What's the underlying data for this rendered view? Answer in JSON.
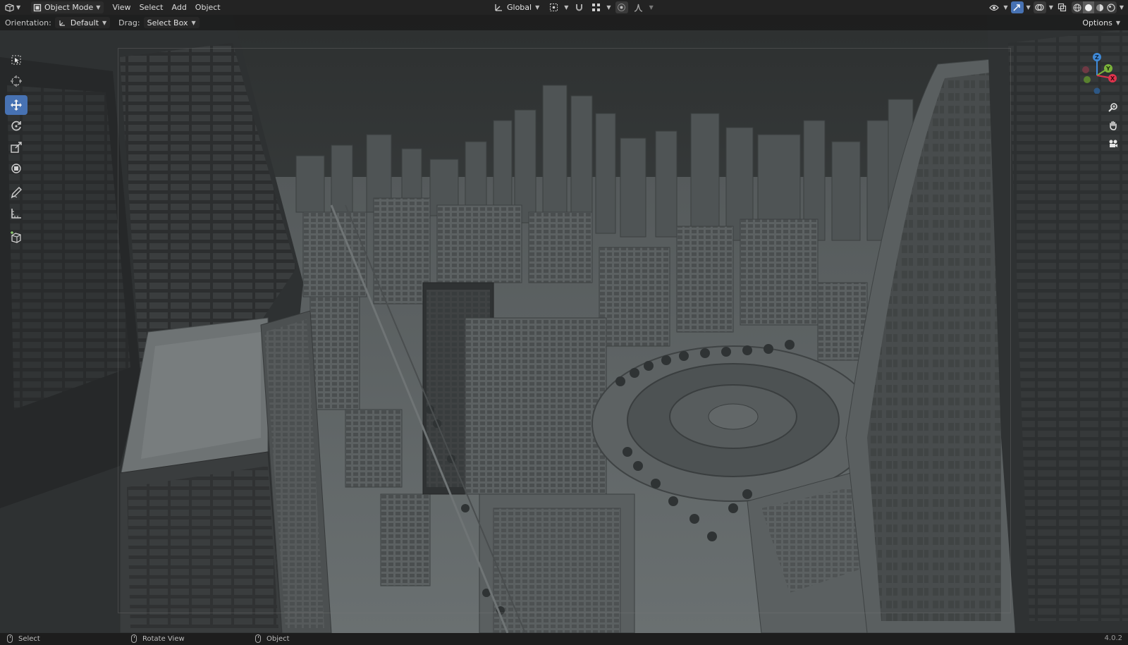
{
  "header": {
    "mode": "Object Mode",
    "menus": [
      "View",
      "Select",
      "Add",
      "Object"
    ],
    "transform_orientation": "Global"
  },
  "tool_settings": {
    "orientation_label": "Orientation:",
    "orientation_value": "Default",
    "drag_label": "Drag:",
    "drag_value": "Select Box",
    "options_label": "Options"
  },
  "toolshelf": {
    "tools": [
      "select-box",
      "cursor",
      "move",
      "rotate",
      "scale",
      "transform",
      "annotate",
      "measure",
      "add-cube"
    ],
    "active_tool": "move"
  },
  "gizmo": {
    "axes": [
      "X",
      "Y",
      "Z"
    ],
    "colors": {
      "x": "#e0334d",
      "y": "#7bb33b",
      "z": "#3f8ad8"
    }
  },
  "status_bar": {
    "left": "Select",
    "middle": "Rotate View",
    "right": "Object",
    "version": "4.0.2"
  },
  "colors": {
    "accent": "#4772b3",
    "header_bg": "#232323",
    "viewport_bg": "#3a3d3e"
  }
}
